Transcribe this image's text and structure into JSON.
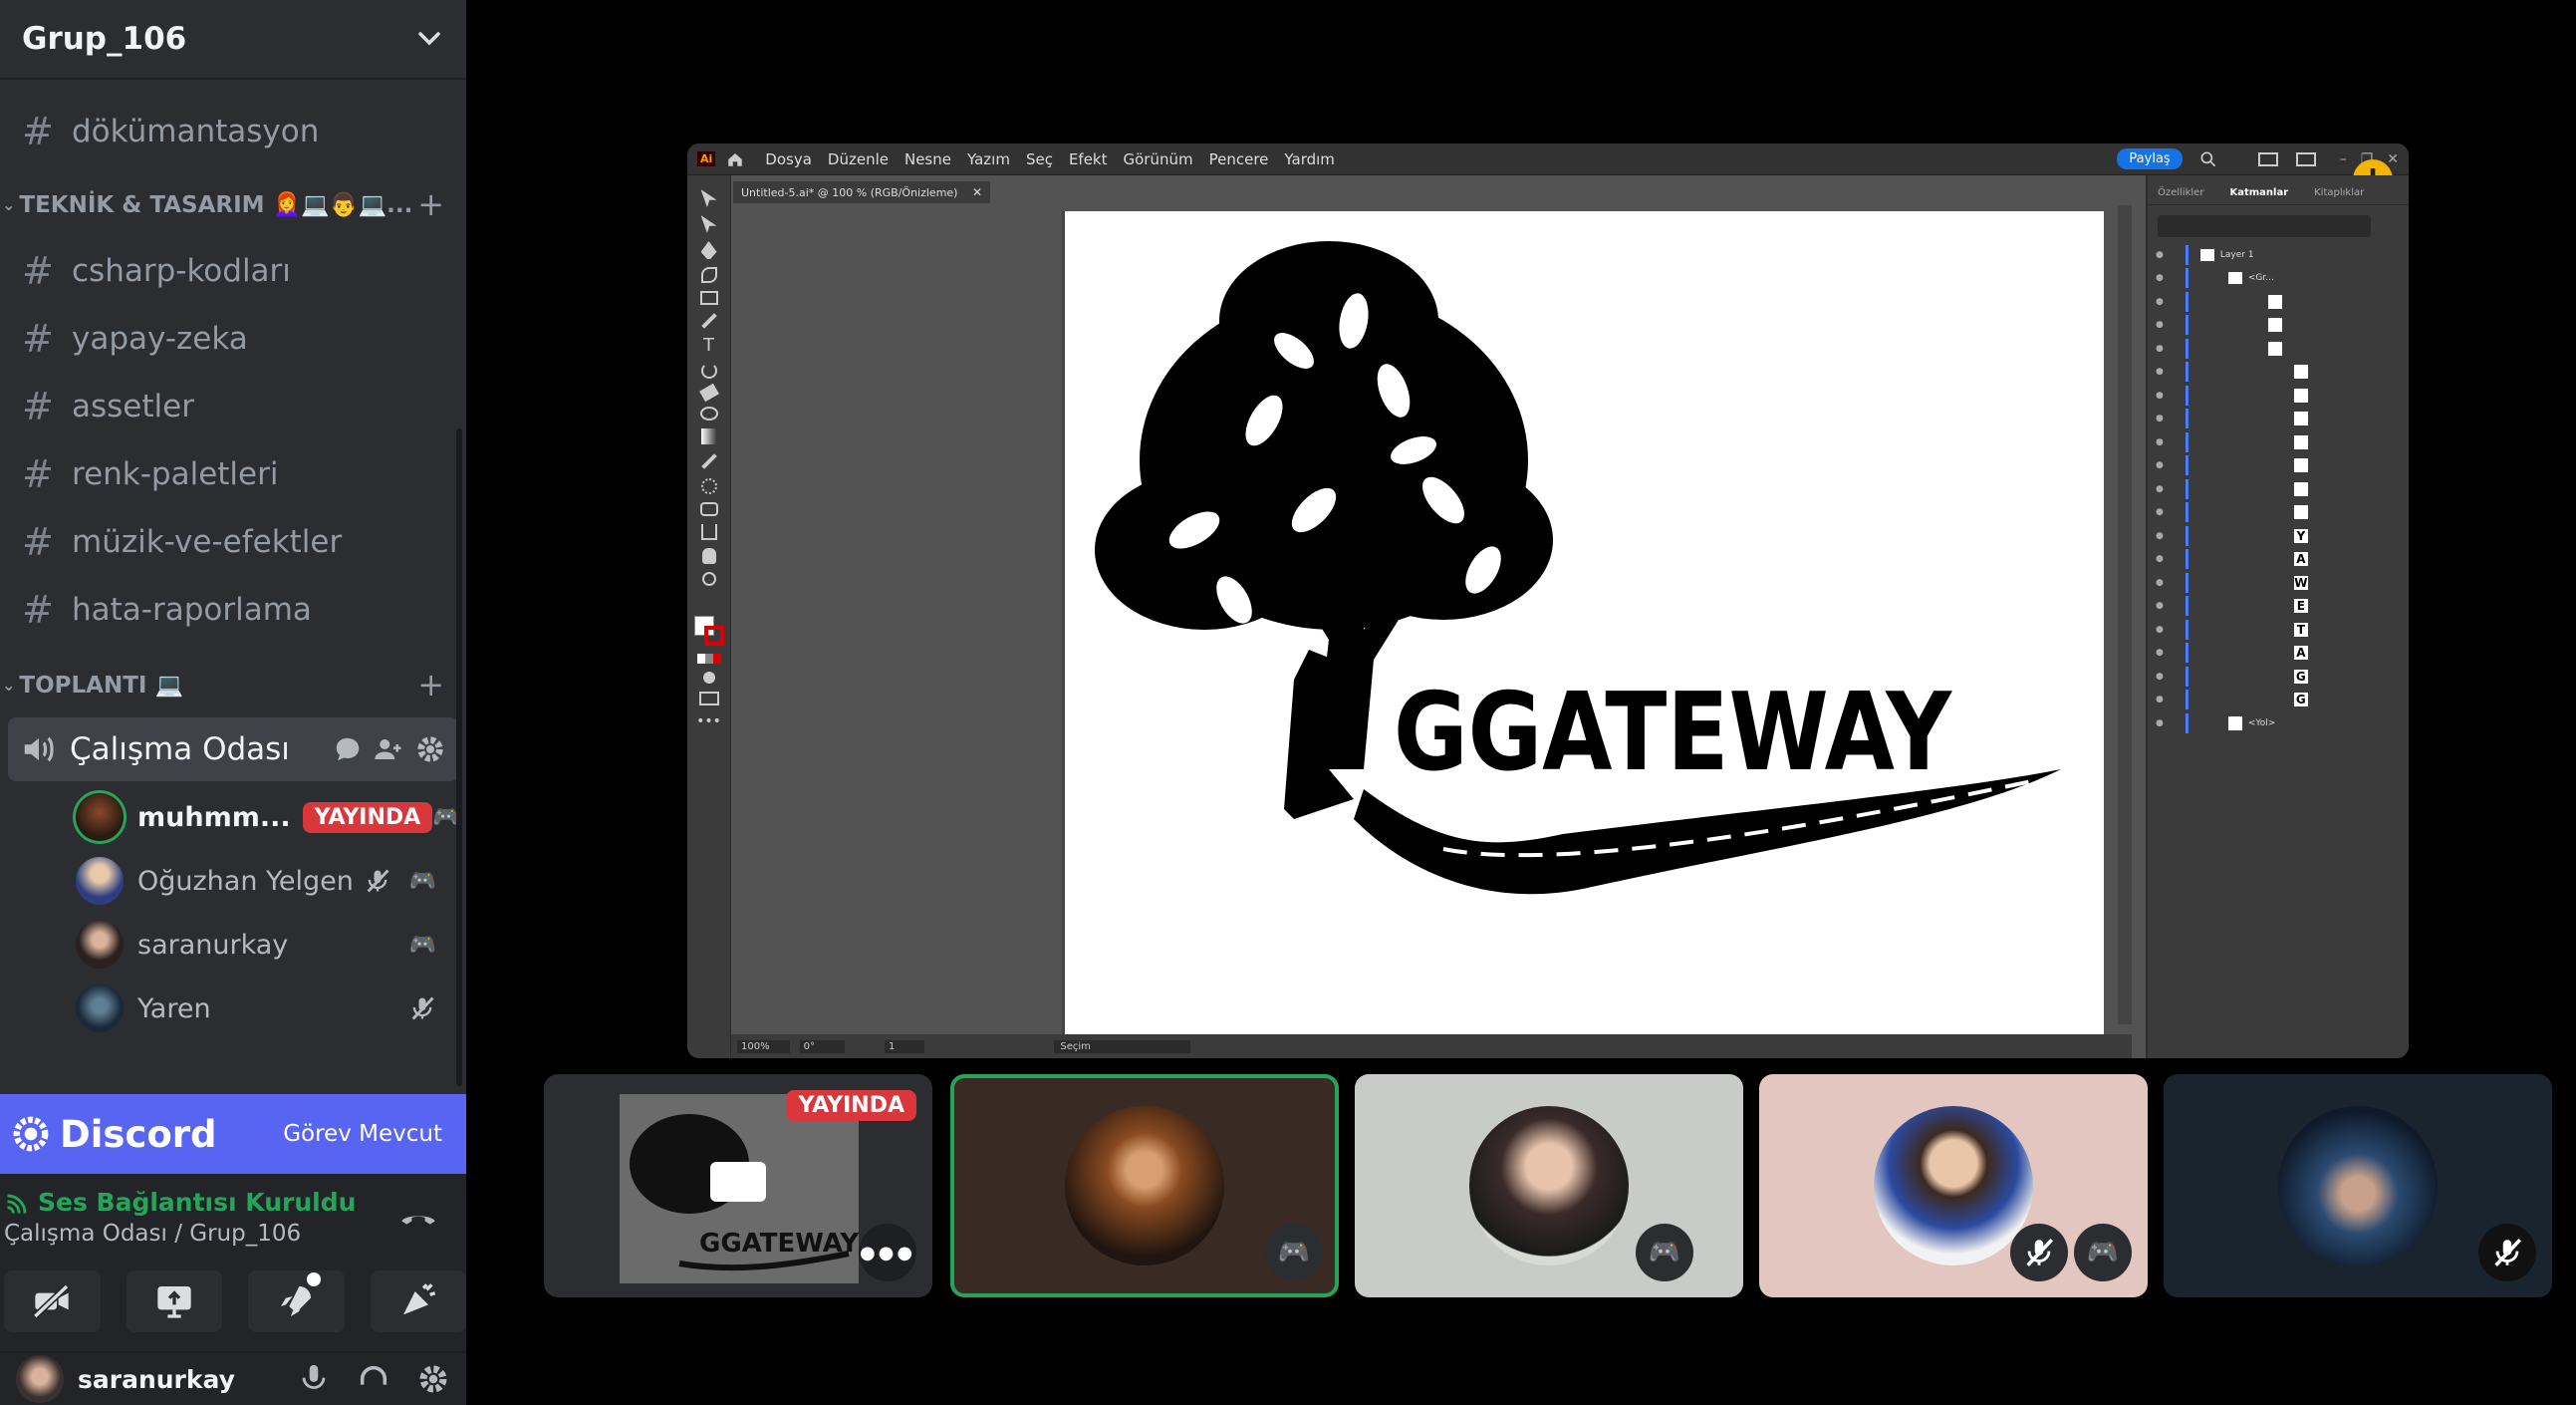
{
  "server": {
    "name": "Grup_106"
  },
  "channels_top": [
    {
      "name": "dökümantasyon"
    }
  ],
  "category_teknik": {
    "label": "TEKNİK & TASARIM 👩‍🦰💻👨💻..."
  },
  "channels_teknik": [
    {
      "name": "csharp-kodları"
    },
    {
      "name": "yapay-zeka"
    },
    {
      "name": "assetler"
    },
    {
      "name": "renk-paletleri"
    },
    {
      "name": "müzik-ve-efektler"
    },
    {
      "name": "hata-raporlama"
    }
  ],
  "category_toplanti": {
    "label": "TOPLANTI 💻"
  },
  "voice_channel": {
    "name": "Çalışma Odası"
  },
  "voice_users": [
    {
      "name": "muhmm...",
      "badge": "YAYINDA"
    },
    {
      "name": "Oğuzhan Yelgen"
    },
    {
      "name": "saranurkay"
    },
    {
      "name": "Yaren"
    }
  ],
  "discord_bar": {
    "brand": "Discord",
    "action": "Görev Mevcut"
  },
  "voice_status": {
    "title": "Ses Bağlantısı Kuruldu",
    "subtitle": "Çalışma Odası / Grup_106"
  },
  "user_bar": {
    "username": "saranurkay"
  },
  "illustrator": {
    "menu": [
      "Dosya",
      "Düzenle",
      "Nesne",
      "Yazım",
      "Seç",
      "Efekt",
      "Görünüm",
      "Pencere",
      "Yardım"
    ],
    "share_button": "Paylaş",
    "doc_tab": "Untitled-5.ai* @ 100 % (RGB/Önizleme)",
    "panel_tabs": [
      "Özellikler",
      "Katmanlar",
      "Kitaplıklar"
    ],
    "layer_root": "Layer 1",
    "layer_group": "<Gr...",
    "layer_path": "<Yol>",
    "zoom": "100%",
    "rotation": "0°",
    "artboard_num": "1",
    "status": "Seçim",
    "logo_text": "GGATEWAY",
    "layer_letters": [
      "Y",
      "A",
      "W",
      "E",
      "T",
      "A",
      "G",
      "G"
    ]
  },
  "tiles": [
    {
      "badge": "YAYINDA",
      "thumb_text": "GGATEWAY"
    }
  ],
  "colors": {
    "sidebar_bg": "#2b2d31",
    "blurple": "#5865f2",
    "live_red": "#da373c",
    "connected_green": "#23a55a",
    "speaking_green": "#23a55a"
  }
}
